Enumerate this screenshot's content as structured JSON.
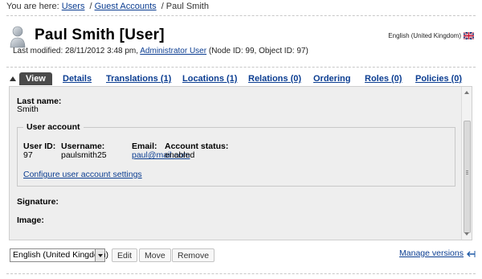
{
  "breadcrumb": {
    "prefix": "You are here:",
    "items": [
      "Users",
      "Guest Accounts"
    ],
    "current": "Paul Smith",
    "separator": "/"
  },
  "header": {
    "title": "Paul Smith [User]",
    "meta_prefix": "Last modified: 28/11/2012 3:48 pm,",
    "meta_author": "Administrator User",
    "meta_suffix": "(Node ID: 99, Object ID: 97)",
    "language": "English (United Kingdom)",
    "icon": "user-icon",
    "flag_icon": "uk-flag-icon"
  },
  "tabs": [
    {
      "label": "View",
      "active": true
    },
    {
      "label": "Details"
    },
    {
      "label": "Translations (1)"
    },
    {
      "label": "Locations (1)"
    },
    {
      "label": "Relations (0)"
    },
    {
      "label": "Ordering"
    },
    {
      "label": "Roles (0)"
    },
    {
      "label": "Policies (0)"
    }
  ],
  "content": {
    "last_name_label": "Last name:",
    "last_name_value": "Smith",
    "user_account": {
      "legend": "User account",
      "user_id_label": "User ID:",
      "user_id_value": "97",
      "username_label": "Username:",
      "username_value": "paulsmith25",
      "email_label": "Email:",
      "email_value": "paul@mail.com",
      "status_label": "Account status:",
      "status_value": "enabled",
      "configure_link": "Configure user account settings"
    },
    "signature_label": "Signature:",
    "image_label": "Image:"
  },
  "bottom": {
    "language_select": "English (United Kingdom)",
    "edit_button": "Edit",
    "move_button": "Move",
    "remove_button": "Remove",
    "manage_versions": "Manage versions",
    "history_icon": "history-icon"
  },
  "colors": {
    "link": "#0b3d91",
    "active_tab_bg": "#4a4a4a",
    "panel_bg": "#eeeeee"
  }
}
